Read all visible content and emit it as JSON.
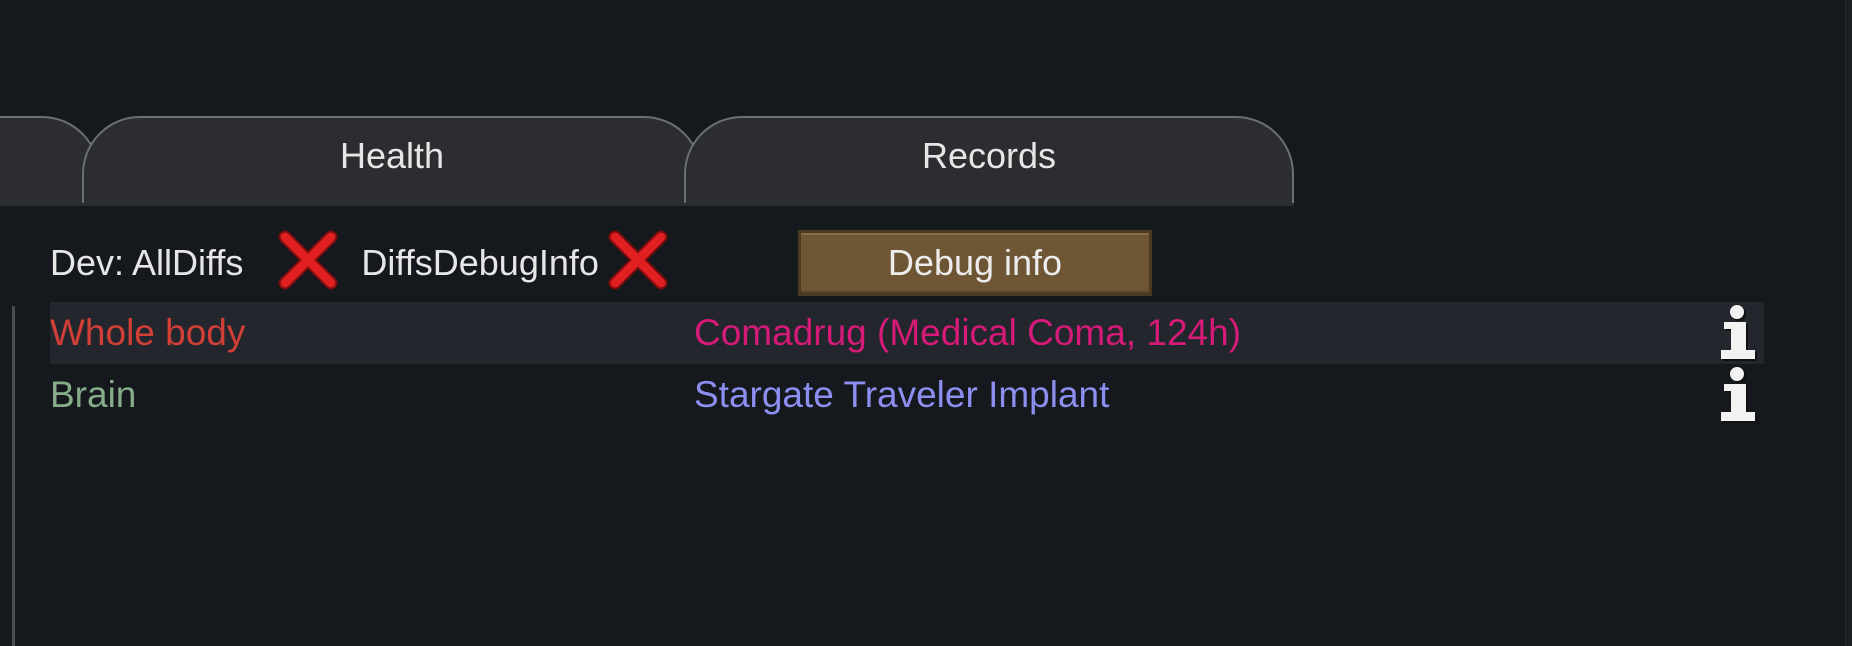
{
  "tabs": [
    {
      "label": ""
    },
    {
      "label": "Health"
    },
    {
      "label": "Records"
    }
  ],
  "dev": {
    "all_diffs_label": "Dev: AllDiffs",
    "diffs_debug_label": "DiffsDebugInfo",
    "toggle_icon": "x-icon",
    "debug_button_label": "Debug info"
  },
  "health_rows": [
    {
      "part": "Whole body",
      "condition": "Comadrug (Medical Coma, 124h)",
      "icon": "info-icon"
    },
    {
      "part": "Brain",
      "condition": "Stargate Traveler Implant",
      "icon": "info-icon"
    }
  ],
  "colors": {
    "background": "#15181c",
    "tab_fill": "#2b2d30",
    "tab_border": "#6b6e72",
    "row_highlight": "#23262c",
    "whole_body": "#d23f36",
    "brain": "#86ad8a",
    "comadrug": "#d51a78",
    "implant": "#8c8ff0",
    "debug_button": "#6e5533",
    "toggle_off_red": "#e02020"
  }
}
